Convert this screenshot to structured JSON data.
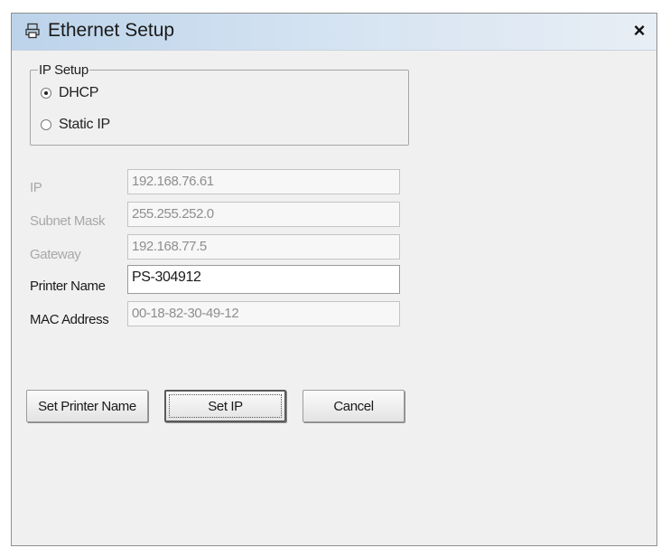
{
  "window": {
    "title": "Ethernet Setup",
    "close_label": "×"
  },
  "ip_setup": {
    "legend": "IP Setup",
    "options": [
      {
        "label": "DHCP",
        "selected": true
      },
      {
        "label": "Static IP",
        "selected": false
      }
    ]
  },
  "fields": {
    "ip": {
      "label": "IP",
      "value": "192.168.76.61",
      "enabled": false
    },
    "subnet_mask": {
      "label": "Subnet Mask",
      "value": "255.255.252.0",
      "enabled": false
    },
    "gateway": {
      "label": "Gateway",
      "value": "192.168.77.5",
      "enabled": false
    },
    "printer_name": {
      "label": "Printer Name",
      "value": "PS-304912",
      "enabled": true
    },
    "mac_address": {
      "label": "MAC Address",
      "value": "00-18-82-30-49-12",
      "enabled": false
    }
  },
  "buttons": {
    "set_printer_name": "Set Printer Name",
    "set_ip": "Set IP",
    "cancel": "Cancel"
  },
  "colors": {
    "titlebar": "#bcd3ea",
    "dialog_bg": "#f0f0f0",
    "disabled_text": "#a8a8a8"
  },
  "icons": {
    "title_icon": "printer-icon",
    "close_icon": "close-icon"
  }
}
